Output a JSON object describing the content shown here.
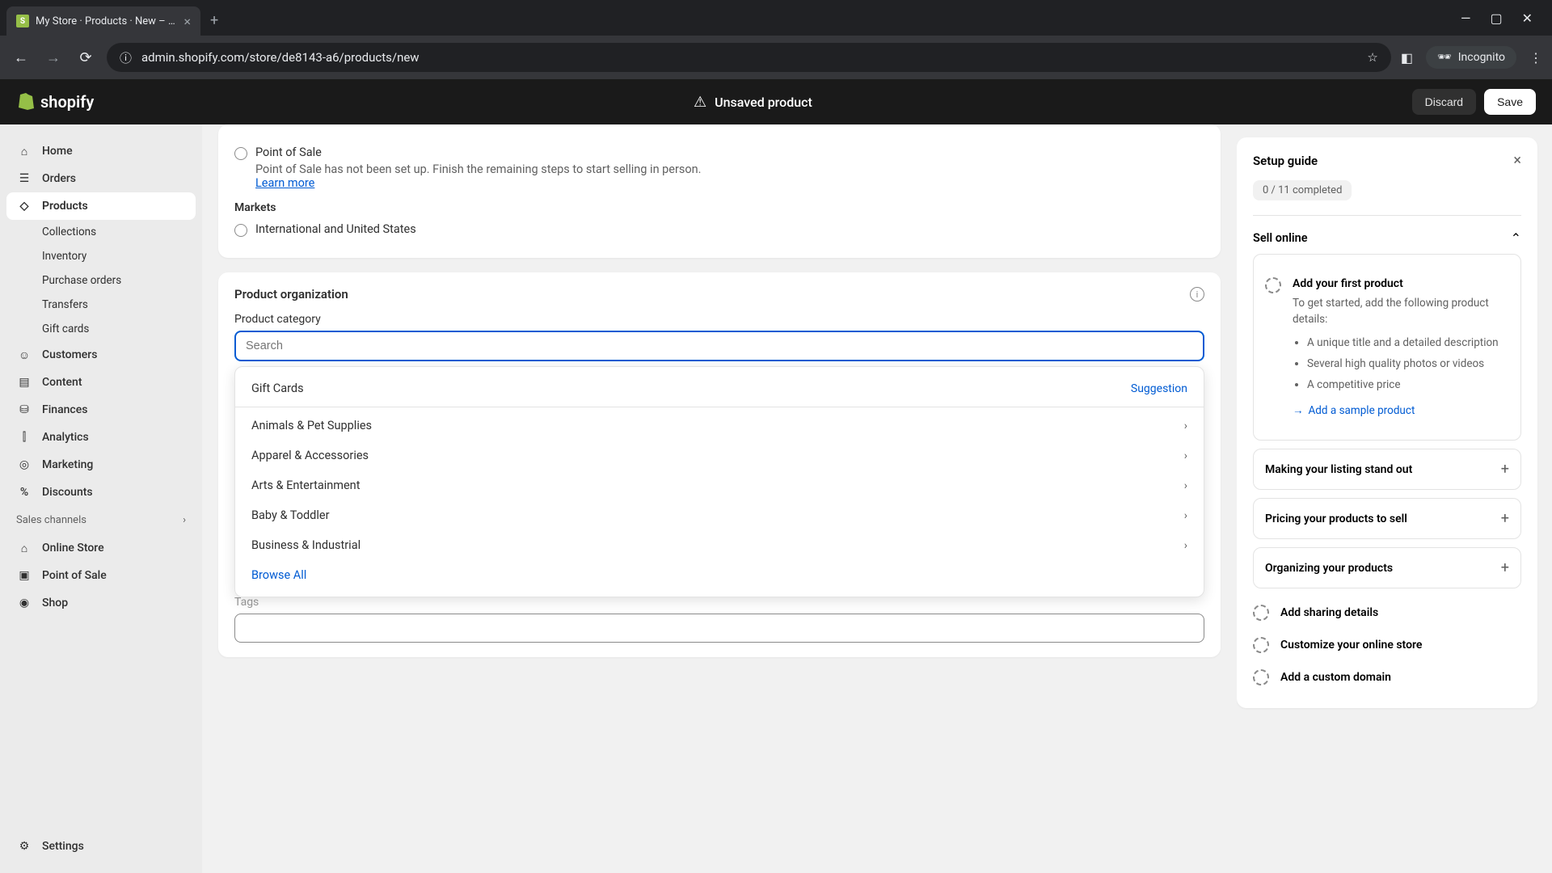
{
  "browser": {
    "tab_title": "My Store · Products · New – Sho",
    "url": "admin.shopify.com/store/de8143-a6/products/new",
    "incognito": "Incognito"
  },
  "topbar": {
    "logo": "shopify",
    "unsaved": "Unsaved product",
    "discard": "Discard",
    "save": "Save"
  },
  "sidebar": {
    "home": "Home",
    "orders": "Orders",
    "products": "Products",
    "collections": "Collections",
    "inventory": "Inventory",
    "purchase_orders": "Purchase orders",
    "transfers": "Transfers",
    "gift_cards": "Gift cards",
    "customers": "Customers",
    "content": "Content",
    "finances": "Finances",
    "analytics": "Analytics",
    "marketing": "Marketing",
    "discounts": "Discounts",
    "sales_channels": "Sales channels",
    "online_store": "Online Store",
    "point_of_sale": "Point of Sale",
    "shop": "Shop",
    "settings": "Settings"
  },
  "content": {
    "pos_label": "Point of Sale",
    "pos_desc": "Point of Sale has not been set up. Finish the remaining steps to start selling in person.",
    "learn_more": "Learn more",
    "markets": "Markets",
    "markets_value": "International and United States",
    "org_title": "Product organization",
    "category_label": "Product category",
    "search_placeholder": "Search",
    "tags_label": "Tags",
    "dropdown": {
      "gift_cards": "Gift Cards",
      "suggestion": "Suggestion",
      "animals": "Animals & Pet Supplies",
      "apparel": "Apparel & Accessories",
      "arts": "Arts & Entertainment",
      "baby": "Baby & Toddler",
      "business": "Business & Industrial",
      "browse_all": "Browse All"
    }
  },
  "setup": {
    "title": "Setup guide",
    "progress": "0 / 11 completed",
    "sell_online": "Sell online",
    "add_product": "Add your first product",
    "add_product_desc": "To get started, add the following product details:",
    "detail1": "A unique title and a detailed description",
    "detail2": "Several high quality photos or videos",
    "detail3": "A competitive price",
    "sample_link": "Add a sample product",
    "making_listing": "Making your listing stand out",
    "pricing": "Pricing your products to sell",
    "organizing": "Organizing your products",
    "sharing": "Add sharing details",
    "customize": "Customize your online store",
    "domain": "Add a custom domain"
  }
}
